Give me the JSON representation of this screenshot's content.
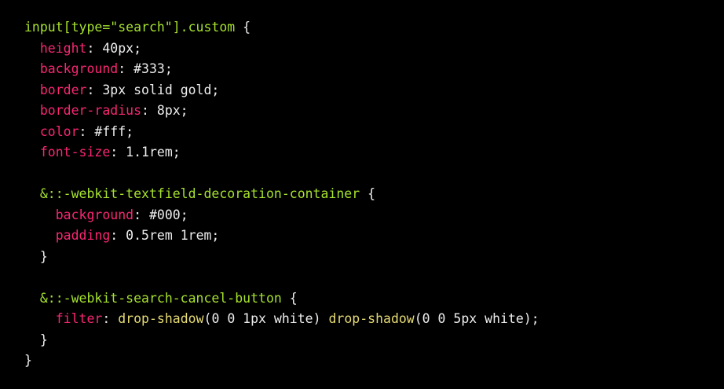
{
  "colors": {
    "background": "#000000",
    "selector": "#a6e22e",
    "property": "#f92672",
    "function": "#e6db74",
    "text": "#eeeeee"
  },
  "code": {
    "lines": [
      [
        {
          "t": "input[type=\"search\"].custom",
          "c": "selector"
        },
        {
          "t": " {",
          "c": "text"
        }
      ],
      [
        {
          "t": "  ",
          "c": "text"
        },
        {
          "t": "height",
          "c": "property"
        },
        {
          "t": ": 40px;",
          "c": "text"
        }
      ],
      [
        {
          "t": "  ",
          "c": "text"
        },
        {
          "t": "background",
          "c": "property"
        },
        {
          "t": ": #333;",
          "c": "text"
        }
      ],
      [
        {
          "t": "  ",
          "c": "text"
        },
        {
          "t": "border",
          "c": "property"
        },
        {
          "t": ": 3px solid gold;",
          "c": "text"
        }
      ],
      [
        {
          "t": "  ",
          "c": "text"
        },
        {
          "t": "border-radius",
          "c": "property"
        },
        {
          "t": ": 8px;",
          "c": "text"
        }
      ],
      [
        {
          "t": "  ",
          "c": "text"
        },
        {
          "t": "color",
          "c": "property"
        },
        {
          "t": ": #fff;",
          "c": "text"
        }
      ],
      [
        {
          "t": "  ",
          "c": "text"
        },
        {
          "t": "font-size",
          "c": "property"
        },
        {
          "t": ": 1.1rem;",
          "c": "text"
        }
      ],
      [],
      [
        {
          "t": "  ",
          "c": "text"
        },
        {
          "t": "&::-webkit-textfield-decoration-container",
          "c": "selector"
        },
        {
          "t": " {",
          "c": "text"
        }
      ],
      [
        {
          "t": "    ",
          "c": "text"
        },
        {
          "t": "background",
          "c": "property"
        },
        {
          "t": ": #000;",
          "c": "text"
        }
      ],
      [
        {
          "t": "    ",
          "c": "text"
        },
        {
          "t": "padding",
          "c": "property"
        },
        {
          "t": ": 0.5rem 1rem;",
          "c": "text"
        }
      ],
      [
        {
          "t": "  }",
          "c": "text"
        }
      ],
      [],
      [
        {
          "t": "  ",
          "c": "text"
        },
        {
          "t": "&::-webkit-search-cancel-button",
          "c": "selector"
        },
        {
          "t": " {",
          "c": "text"
        }
      ],
      [
        {
          "t": "    ",
          "c": "text"
        },
        {
          "t": "filter",
          "c": "property"
        },
        {
          "t": ": ",
          "c": "text"
        },
        {
          "t": "drop-shadow",
          "c": "function"
        },
        {
          "t": "(0 0 1px white) ",
          "c": "text"
        },
        {
          "t": "drop-shadow",
          "c": "function"
        },
        {
          "t": "(0 0 5px white);",
          "c": "text"
        }
      ],
      [
        {
          "t": "  }",
          "c": "text"
        }
      ],
      [
        {
          "t": "}",
          "c": "text"
        }
      ]
    ]
  }
}
